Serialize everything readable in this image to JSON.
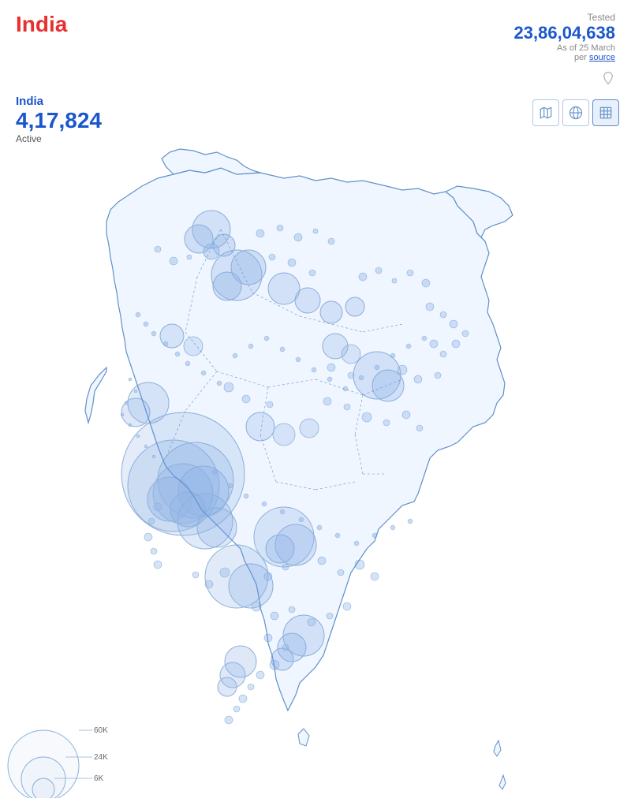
{
  "header": {
    "country": "India",
    "tested": {
      "label": "Tested",
      "value": "23,86,04,638",
      "date": "As of 25 March",
      "per": "per",
      "source": "source"
    }
  },
  "stats": {
    "country": "India",
    "number": "4,17,824",
    "status": "Active"
  },
  "legend": {
    "circles": [
      {
        "label": "60K",
        "size": 90
      },
      {
        "label": "24K",
        "size": 60
      },
      {
        "label": "6K",
        "size": 30
      }
    ]
  },
  "icons": {
    "pin": "📌",
    "map_view": "🗺",
    "globe_view": "🌐",
    "table_view": "📋"
  }
}
